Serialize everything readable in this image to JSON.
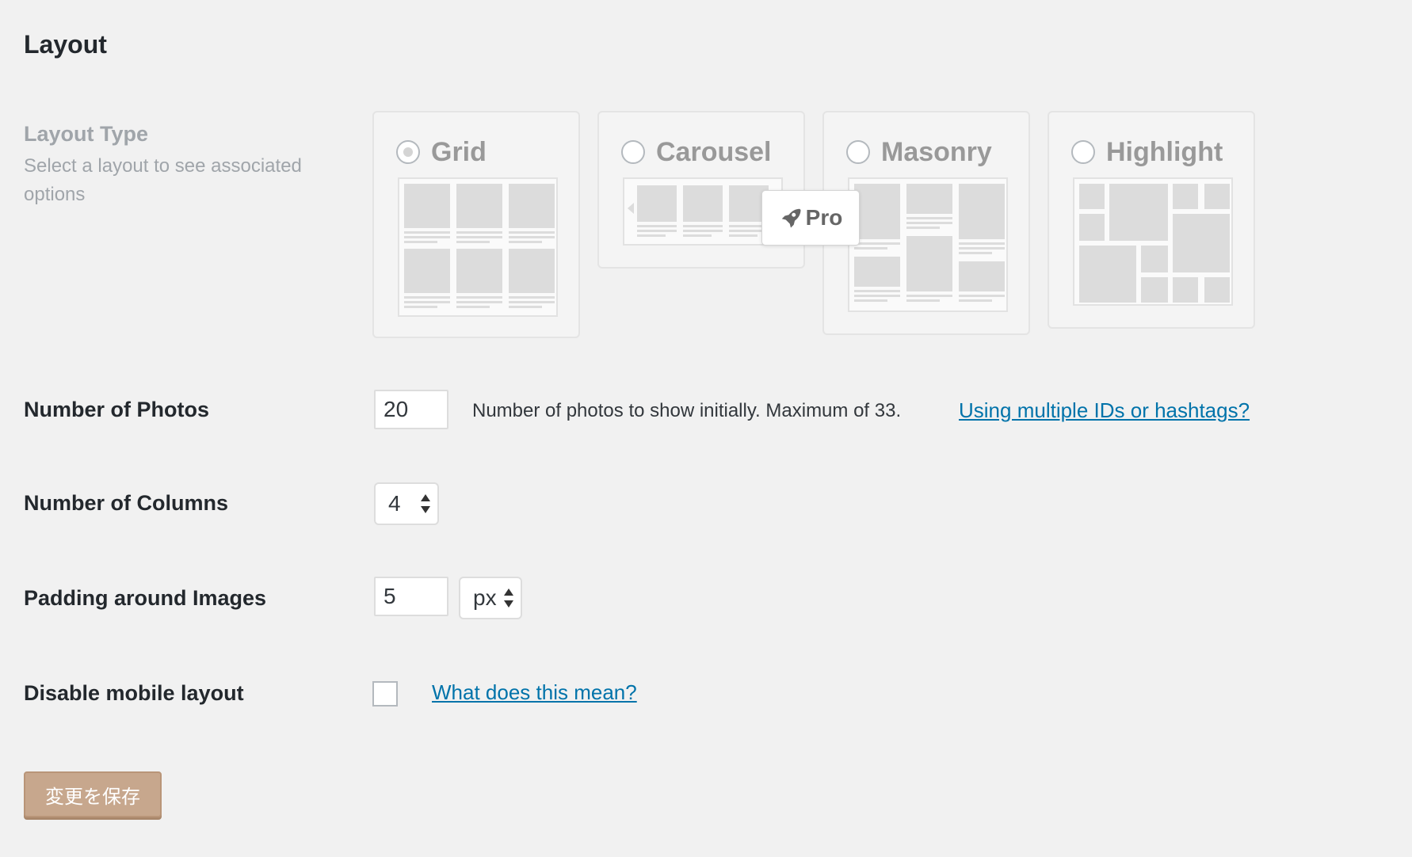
{
  "section": {
    "title": "Layout"
  },
  "layout_type": {
    "label": "Layout Type",
    "description": "Select a layout to see associated options",
    "options": [
      {
        "label": "Grid",
        "selected": true
      },
      {
        "label": "Carousel",
        "selected": false
      },
      {
        "label": "Masonry",
        "selected": false
      },
      {
        "label": "Highlight",
        "selected": false
      }
    ],
    "pro_badge": "Pro"
  },
  "photos": {
    "label": "Number of Photos",
    "value": "20",
    "help": "Number of photos to show initially. Maximum of 33.",
    "link": "Using multiple IDs or hashtags?"
  },
  "columns": {
    "label": "Number of Columns",
    "value": "4"
  },
  "padding": {
    "label": "Padding around Images",
    "value": "5",
    "unit": "px"
  },
  "mobile": {
    "label": "Disable mobile layout",
    "checked": false,
    "link": "What does this mean?"
  },
  "save_button": {
    "label": "変更を保存",
    "color": "#c7a78d"
  },
  "colors": {
    "link": "#0073aa",
    "muted": "#a0a5aa",
    "background": "#f1f1f1"
  },
  "icons": {
    "pro": "rocket-icon",
    "select": "up-down-arrows-icon"
  }
}
